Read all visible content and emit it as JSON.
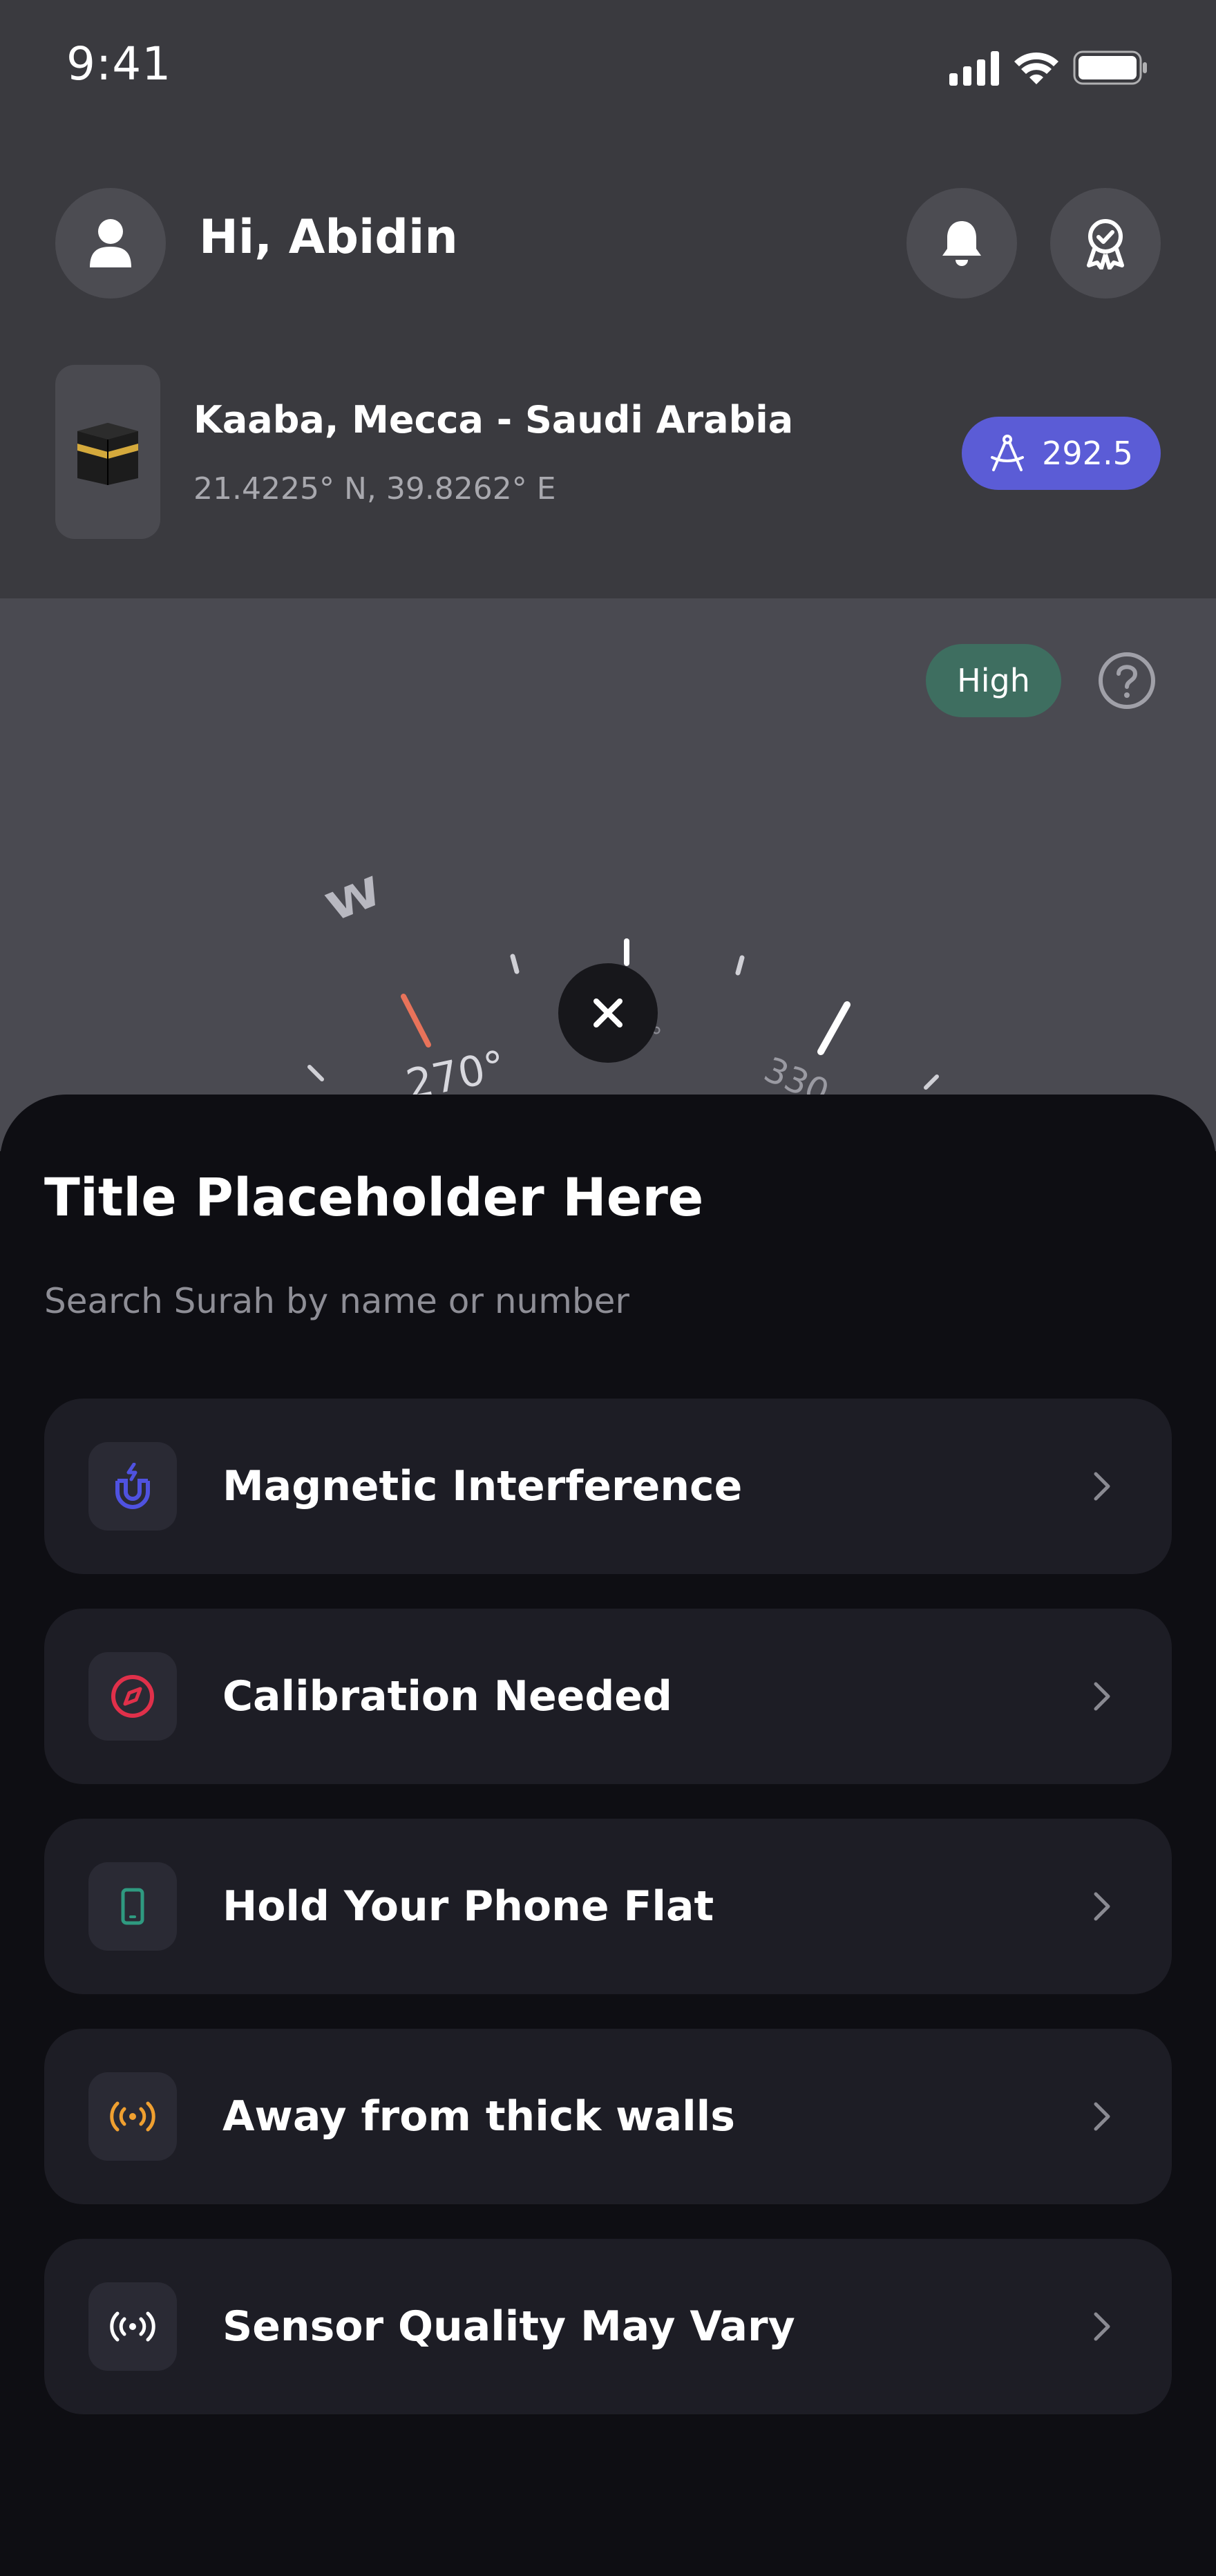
{
  "status_bar": {
    "time": "9:41"
  },
  "header": {
    "greeting": "Hi, Abidin"
  },
  "location": {
    "name": "Kaaba, Mecca - Saudi Arabia",
    "coordinates": "21.4225° N, 39.8262° E",
    "bearing": "292.5"
  },
  "compass": {
    "accuracy": "High",
    "direction_label": "W",
    "degree_labels": [
      "270°",
      "°",
      "330"
    ]
  },
  "sheet": {
    "title": "Title Placeholder Here",
    "subtitle": "Search Surah by name or number",
    "items": [
      {
        "label": "Magnetic Interference",
        "icon": "magnet-icon",
        "color": "#4f52e0"
      },
      {
        "label": "Calibration Needed",
        "icon": "compass-icon",
        "color": "#e0304a"
      },
      {
        "label": "Hold Your Phone Flat",
        "icon": "phone-icon",
        "color": "#2f9a80"
      },
      {
        "label": "Away from thick walls",
        "icon": "signal-icon",
        "color": "#f0a030"
      },
      {
        "label": "Sensor Quality May Vary",
        "icon": "broadcast-icon",
        "color": "#ffffff"
      }
    ]
  },
  "colors": {
    "accent": "#5b5cd6",
    "accuracy_high": "#3e6e60",
    "qibla_marker": "#e8735a"
  }
}
